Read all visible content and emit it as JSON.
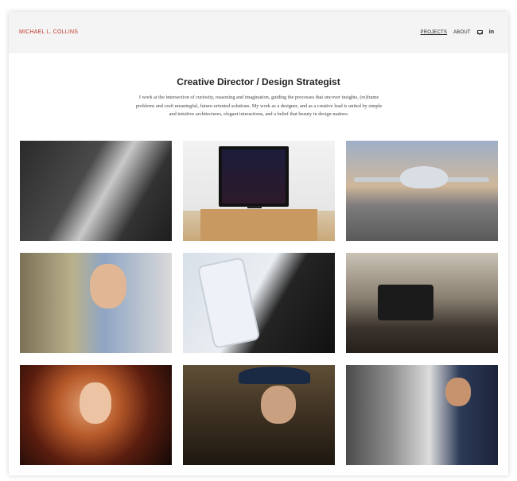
{
  "header": {
    "brand": "MICHAEL L. COLLINS",
    "nav": [
      {
        "label": "PROJECTS",
        "active": true
      },
      {
        "label": "ABOUT",
        "active": false
      }
    ],
    "icons": [
      "mail-icon",
      "linkedin-icon"
    ],
    "linkedin_glyph": "in",
    "brand_color": "#c0392b"
  },
  "main": {
    "title": "Creative Director / Design Strategist",
    "intro": "I work at the intersection of curiosity, reasoning and imagination, guiding the processes that uncover insights, (re)frame problems and craft meaningful, future-oriented solutions. My work as a designer, and as a creative lead is united by simple and intuitive architectures, elegant interactions, and a belief that beauty in design matters."
  }
}
